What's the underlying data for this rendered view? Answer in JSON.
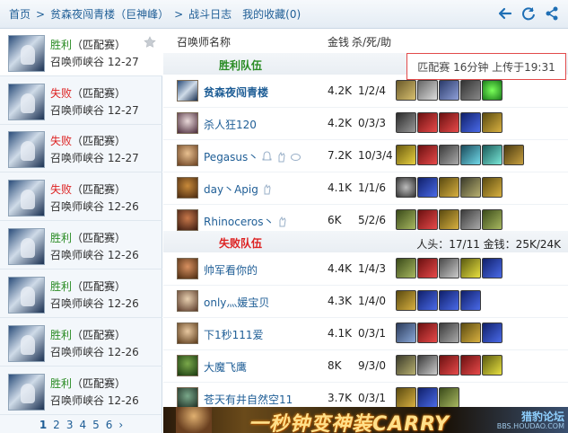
{
  "nav": {
    "home": "首页",
    "summoner": "贫森夜闯青楼（巨神峰）",
    "battle_log": "战斗日志",
    "favorites": "我的收藏(0)",
    "sep": ">"
  },
  "sidebar": {
    "items": [
      {
        "result": "胜利",
        "mode": "（匹配赛）",
        "map": "召唤师峡谷",
        "date": "12-27",
        "win": true,
        "active": true
      },
      {
        "result": "失败",
        "mode": "（匹配赛）",
        "map": "召唤师峡谷",
        "date": "12-27",
        "win": false
      },
      {
        "result": "失败",
        "mode": "（匹配赛）",
        "map": "召唤师峡谷",
        "date": "12-27",
        "win": false
      },
      {
        "result": "失败",
        "mode": "（匹配赛）",
        "map": "召唤师峡谷",
        "date": "12-26",
        "win": false
      },
      {
        "result": "胜利",
        "mode": "（匹配赛）",
        "map": "召唤师峡谷",
        "date": "12-26",
        "win": true
      },
      {
        "result": "胜利",
        "mode": "（匹配赛）",
        "map": "召唤师峡谷",
        "date": "12-26",
        "win": true
      },
      {
        "result": "胜利",
        "mode": "（匹配赛）",
        "map": "召唤师峡谷",
        "date": "12-26",
        "win": true
      },
      {
        "result": "胜利",
        "mode": "（匹配赛）",
        "map": "召唤师峡谷",
        "date": "12-26",
        "win": true
      }
    ],
    "pages": [
      "1",
      "2",
      "3",
      "4",
      "5",
      "6"
    ],
    "current_page": "1",
    "next": "›"
  },
  "table": {
    "col_name": "召唤师名称",
    "col_gold": "金钱",
    "col_kda": "杀/死/助"
  },
  "match_info": "匹配赛 16分钟 上传于19:31",
  "win_team": {
    "label": "胜利队伍",
    "players": [
      {
        "name": "贫森夜闯青楼",
        "gold": "4.2K",
        "kda": "1/2/4",
        "me": true
      },
      {
        "name": "杀人狂120",
        "gold": "4.2K",
        "kda": "0/3/3"
      },
      {
        "name": "Pegasus丶",
        "gold": "7.2K",
        "kda": "10/3/4"
      },
      {
        "name": "day丶Apig",
        "gold": "4.1K",
        "kda": "1/1/6"
      },
      {
        "name": "Rhinoceros丶",
        "gold": "6K",
        "kda": "5/2/6"
      }
    ]
  },
  "lose_team": {
    "label": "失败队伍",
    "stats": "人头：17/11  金钱：25K/24K",
    "players": [
      {
        "name": "帅军看你的",
        "gold": "4.4K",
        "kda": "1/4/3"
      },
      {
        "name": "only灬媛宝贝",
        "gold": "4.3K",
        "kda": "1/4/0"
      },
      {
        "name": "下1秒111爱",
        "gold": "4.1K",
        "kda": "0/3/1"
      },
      {
        "name": "大魔飞鹰",
        "gold": "8K",
        "kda": "9/3/0"
      },
      {
        "name": "苍天有井自然空11",
        "gold": "3.7K",
        "kda": "0/3/1"
      }
    ]
  },
  "banner": {
    "text": "一秒钟变神装CARRY",
    "site": "猎豹论坛",
    "url": "BBS.HOUDAO.COM"
  },
  "icons": [
    "back-arrow-icon",
    "refresh-icon",
    "share-icon",
    "star-icon",
    "bell-badge-icon",
    "hand-badge-icon"
  ],
  "colors": {
    "accent": "#1f5e96",
    "win": "#2a8c24",
    "lose": "#dd2222",
    "highlight_border": "#e24a4a"
  }
}
